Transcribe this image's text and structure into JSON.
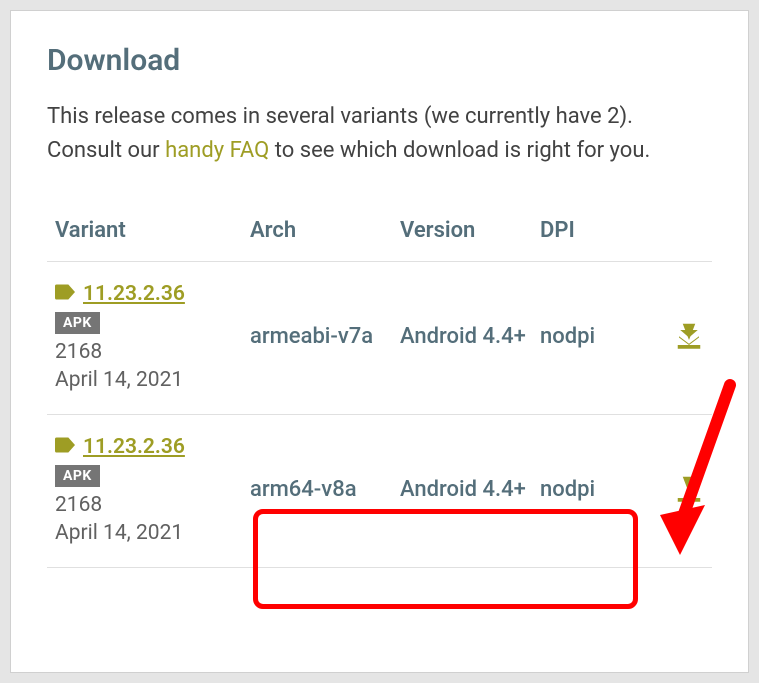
{
  "title": "Download",
  "description_part1": "This release comes in several variants (we currently have 2). Consult our ",
  "faq_link": "handy FAQ",
  "description_part2": " to see which download is right for you.",
  "table": {
    "headers": {
      "variant": "Variant",
      "arch": "Arch",
      "version": "Version",
      "dpi": "DPI"
    },
    "rows": [
      {
        "version": "11.23.2.36",
        "badge": "APK",
        "build": "2168",
        "date": "April 14, 2021",
        "arch": "armeabi-v7a",
        "os_version": "Android 4.4+",
        "dpi": "nodpi"
      },
      {
        "version": "11.23.2.36",
        "badge": "APK",
        "build": "2168",
        "date": "April 14, 2021",
        "arch": "arm64-v8a",
        "os_version": "Android 4.4+",
        "dpi": "nodpi"
      }
    ]
  }
}
